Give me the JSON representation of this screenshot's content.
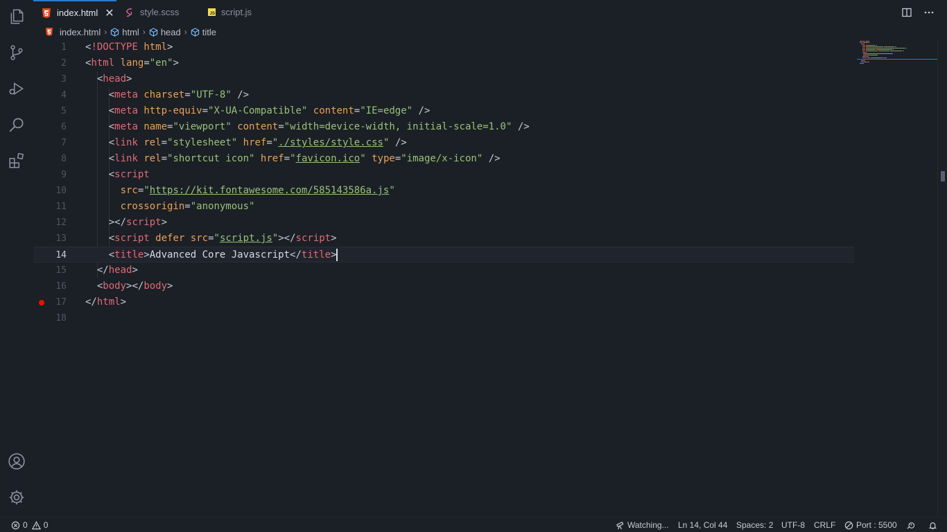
{
  "tabs": [
    {
      "label": "index.html",
      "icon": "html5-icon",
      "active": true,
      "close": "✕"
    },
    {
      "label": "style.scss",
      "icon": "sass-icon",
      "active": false
    },
    {
      "label": "script.js",
      "icon": "js-icon",
      "active": false,
      "badge": "JS"
    }
  ],
  "breadcrumb": {
    "file": "index.html",
    "items": [
      "html",
      "head",
      "title"
    ]
  },
  "editor": {
    "current_line": 14,
    "breakpoint_line": 17,
    "line_numbers": [
      "1",
      "2",
      "3",
      "4",
      "5",
      "6",
      "7",
      "8",
      "9",
      "10",
      "11",
      "12",
      "13",
      "14",
      "15",
      "16",
      "17",
      "18"
    ],
    "lines": [
      [
        [
          "t-punc",
          "<"
        ],
        [
          "t-doc",
          "!DOCTYPE"
        ],
        [
          "t-punc",
          " "
        ],
        [
          "t-attr",
          "html"
        ],
        [
          "t-punc",
          ">"
        ]
      ],
      [
        [
          "t-punc",
          "<"
        ],
        [
          "t-tag",
          "html"
        ],
        [
          "t-punc",
          " "
        ],
        [
          "t-attr",
          "lang"
        ],
        [
          "t-punc",
          "="
        ],
        [
          "t-str",
          "\"en\""
        ],
        [
          "t-punc",
          ">"
        ]
      ],
      [
        [
          "t-punc",
          "  <"
        ],
        [
          "t-tag",
          "head"
        ],
        [
          "t-punc",
          ">"
        ]
      ],
      [
        [
          "t-punc",
          "    <"
        ],
        [
          "t-tag",
          "meta"
        ],
        [
          "t-punc",
          " "
        ],
        [
          "t-attr",
          "charset"
        ],
        [
          "t-punc",
          "="
        ],
        [
          "t-str",
          "\"UTF-8\""
        ],
        [
          "t-punc",
          " />"
        ]
      ],
      [
        [
          "t-punc",
          "    <"
        ],
        [
          "t-tag",
          "meta"
        ],
        [
          "t-punc",
          " "
        ],
        [
          "t-attr",
          "http-equiv"
        ],
        [
          "t-punc",
          "="
        ],
        [
          "t-str",
          "\"X-UA-Compatible\""
        ],
        [
          "t-punc",
          " "
        ],
        [
          "t-attr",
          "content"
        ],
        [
          "t-punc",
          "="
        ],
        [
          "t-str",
          "\"IE=edge\""
        ],
        [
          "t-punc",
          " />"
        ]
      ],
      [
        [
          "t-punc",
          "    <"
        ],
        [
          "t-tag",
          "meta"
        ],
        [
          "t-punc",
          " "
        ],
        [
          "t-attr",
          "name"
        ],
        [
          "t-punc",
          "="
        ],
        [
          "t-str",
          "\"viewport\""
        ],
        [
          "t-punc",
          " "
        ],
        [
          "t-attr",
          "content"
        ],
        [
          "t-punc",
          "="
        ],
        [
          "t-str",
          "\"width=device-width, initial-scale=1.0\""
        ],
        [
          "t-punc",
          " />"
        ]
      ],
      [
        [
          "t-punc",
          "    <"
        ],
        [
          "t-tag",
          "link"
        ],
        [
          "t-punc",
          " "
        ],
        [
          "t-attr",
          "rel"
        ],
        [
          "t-punc",
          "="
        ],
        [
          "t-str",
          "\"stylesheet\""
        ],
        [
          "t-punc",
          " "
        ],
        [
          "t-attr",
          "href"
        ],
        [
          "t-punc",
          "="
        ],
        [
          "t-str",
          "\""
        ],
        [
          "t-link",
          "./styles/style.css"
        ],
        [
          "t-str",
          "\""
        ],
        [
          "t-punc",
          " />"
        ]
      ],
      [
        [
          "t-punc",
          "    <"
        ],
        [
          "t-tag",
          "link"
        ],
        [
          "t-punc",
          " "
        ],
        [
          "t-attr",
          "rel"
        ],
        [
          "t-punc",
          "="
        ],
        [
          "t-str",
          "\"shortcut icon\""
        ],
        [
          "t-punc",
          " "
        ],
        [
          "t-attr",
          "href"
        ],
        [
          "t-punc",
          "="
        ],
        [
          "t-str",
          "\""
        ],
        [
          "t-link",
          "favicon.ico"
        ],
        [
          "t-str",
          "\""
        ],
        [
          "t-punc",
          " "
        ],
        [
          "t-attr",
          "type"
        ],
        [
          "t-punc",
          "="
        ],
        [
          "t-str",
          "\"image/x-icon\""
        ],
        [
          "t-punc",
          " />"
        ]
      ],
      [
        [
          "t-punc",
          "    <"
        ],
        [
          "t-tag",
          "script"
        ]
      ],
      [
        [
          "t-punc",
          "      "
        ],
        [
          "t-attr",
          "src"
        ],
        [
          "t-punc",
          "="
        ],
        [
          "t-str",
          "\""
        ],
        [
          "t-link",
          "https://kit.fontawesome.com/585143586a.js"
        ],
        [
          "t-str",
          "\""
        ]
      ],
      [
        [
          "t-punc",
          "      "
        ],
        [
          "t-attr",
          "crossorigin"
        ],
        [
          "t-punc",
          "="
        ],
        [
          "t-str",
          "\"anonymous\""
        ]
      ],
      [
        [
          "t-punc",
          "    ></"
        ],
        [
          "t-tag",
          "script"
        ],
        [
          "t-punc",
          ">"
        ]
      ],
      [
        [
          "t-punc",
          "    <"
        ],
        [
          "t-tag",
          "script"
        ],
        [
          "t-punc",
          " "
        ],
        [
          "t-attr",
          "defer"
        ],
        [
          "t-punc",
          " "
        ],
        [
          "t-attr",
          "src"
        ],
        [
          "t-punc",
          "="
        ],
        [
          "t-str",
          "\""
        ],
        [
          "t-link",
          "script.js"
        ],
        [
          "t-str",
          "\""
        ],
        [
          "t-punc",
          "></"
        ],
        [
          "t-tag",
          "script"
        ],
        [
          "t-punc",
          ">"
        ]
      ],
      [
        [
          "t-punc",
          "    <"
        ],
        [
          "t-tag",
          "title"
        ],
        [
          "t-punc",
          ">"
        ],
        [
          "t-text",
          "Advanced Core Javascript"
        ],
        [
          "t-punc",
          "</"
        ],
        [
          "t-tag",
          "title"
        ],
        [
          "t-punc",
          ">"
        ]
      ],
      [
        [
          "t-punc",
          "  </"
        ],
        [
          "t-tag",
          "head"
        ],
        [
          "t-punc",
          ">"
        ]
      ],
      [
        [
          "t-punc",
          "  <"
        ],
        [
          "t-tag",
          "body"
        ],
        [
          "t-punc",
          "></"
        ],
        [
          "t-tag",
          "body"
        ],
        [
          "t-punc",
          ">"
        ]
      ],
      [
        [
          "t-punc",
          "</"
        ],
        [
          "t-tag",
          "html"
        ],
        [
          "t-punc",
          ">"
        ]
      ],
      []
    ]
  },
  "status": {
    "errors": "0",
    "warnings": "0",
    "watching": "Watching...",
    "position": "Ln 14, Col 44",
    "spaces": "Spaces: 2",
    "encoding": "UTF-8",
    "eol": "CRLF",
    "port": "Port : 5500"
  },
  "colors": {
    "accent": "#2a7bd1",
    "breakpoint": "#e51400",
    "html_icon": "#e44d26",
    "sass_icon": "#cd6799",
    "js_icon": "#f0db4f"
  }
}
